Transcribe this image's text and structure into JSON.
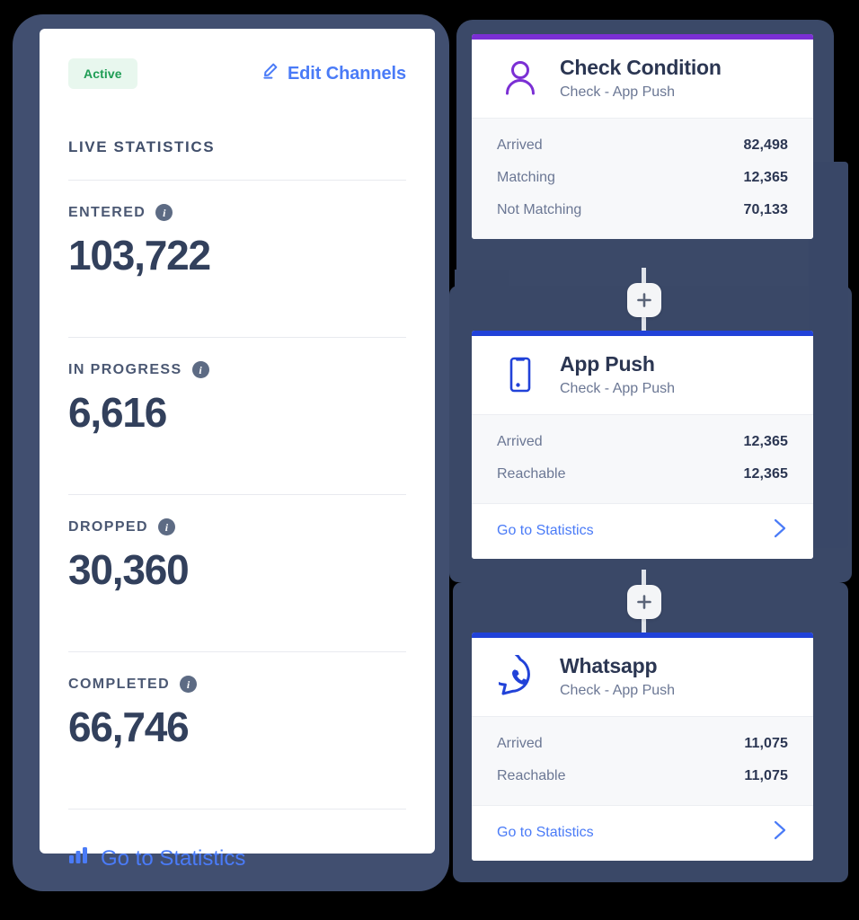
{
  "left_panel": {
    "status_badge": "Active",
    "edit_channels_label": "Edit Channels",
    "section_title": "LIVE STATISTICS",
    "info_glyph": "i",
    "stats": [
      {
        "label": "ENTERED",
        "value": "103,722"
      },
      {
        "label": "IN PROGRESS",
        "value": "6,616"
      },
      {
        "label": "DROPPED",
        "value": "30,360"
      },
      {
        "label": "COMPLETED",
        "value": "66,746"
      }
    ],
    "go_to_statistics_label": "Go to Statistics"
  },
  "flow": {
    "add_button_glyph": "+",
    "cards": [
      {
        "title": "Check Condition",
        "subtitle": "Check - App Push",
        "accent_color": "#7B2FD4",
        "icon": "person-icon",
        "rows": [
          {
            "label": "Arrived",
            "value": "82,498"
          },
          {
            "label": "Matching",
            "value": "12,365"
          },
          {
            "label": "Not Matching",
            "value": "70,133"
          }
        ],
        "footer_label": null
      },
      {
        "title": "App Push",
        "subtitle": "Check - App Push",
        "accent_color": "#2142D8",
        "icon": "mobile-phone-icon",
        "rows": [
          {
            "label": "Arrived",
            "value": "12,365"
          },
          {
            "label": "Reachable",
            "value": "12,365"
          }
        ],
        "footer_label": "Go to Statistics"
      },
      {
        "title": "Whatsapp",
        "subtitle": "Check - App Push",
        "accent_color": "#2142D8",
        "icon": "whatsapp-icon",
        "rows": [
          {
            "label": "Arrived",
            "value": "11,075"
          },
          {
            "label": "Reachable",
            "value": "11,075"
          }
        ],
        "footer_label": "Go to Statistics"
      }
    ]
  },
  "colors": {
    "accent_blue": "#4A7BF7",
    "accent_purple": "#7B2FD4",
    "accent_indigo": "#2142D8",
    "badge_green_text": "#1F9D55",
    "badge_green_bg": "#E8F7EE",
    "backdrop_navy": "#3D4B6B",
    "text_dark": "#2B3652",
    "text_muted": "#6B7794"
  }
}
